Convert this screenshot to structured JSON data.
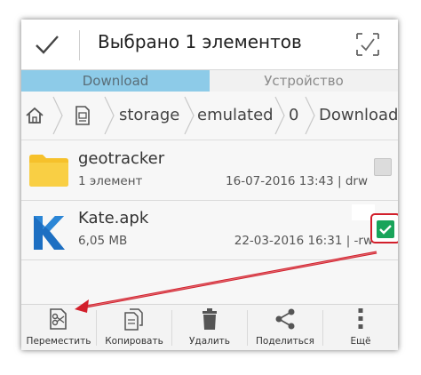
{
  "action_bar": {
    "title": "Выбрано 1 элементов",
    "confirm_icon": "checkmark-icon",
    "select_all_icon": "select-all-icon"
  },
  "tabs": [
    {
      "label": "Download",
      "active": true
    },
    {
      "label": "Устройство",
      "active": false
    }
  ],
  "breadcrumb": {
    "home_icon": "home-icon",
    "sdcard_icon": "sdcard-icon",
    "items": [
      "storage",
      "emulated",
      "0",
      "Download"
    ]
  },
  "files": [
    {
      "name": "geotracker",
      "subtitle": "1 элемент",
      "meta": "16-07-2016 13:43 | drw",
      "icon": "folder-icon",
      "checked": false
    },
    {
      "name": "Kate.apk",
      "subtitle": "6,05 MB",
      "meta": "22-03-2016 16:31 | -rw",
      "icon": "kate-app-icon",
      "checked": true
    }
  ],
  "toolbar": [
    {
      "label": "Переместить",
      "icon": "move-icon"
    },
    {
      "label": "Копировать",
      "icon": "copy-icon"
    },
    {
      "label": "Удалить",
      "icon": "trash-icon"
    },
    {
      "label": "Поделиться",
      "icon": "share-icon"
    },
    {
      "label": "Ещё",
      "icon": "more-icon"
    }
  ],
  "colors": {
    "accent_tab": "#8dcbe8",
    "checkbox_checked": "#19a45a",
    "annotation_red": "#d21f2b",
    "folder_yellow": "#f6c12b",
    "kate_blue": "#1d6fc2"
  }
}
